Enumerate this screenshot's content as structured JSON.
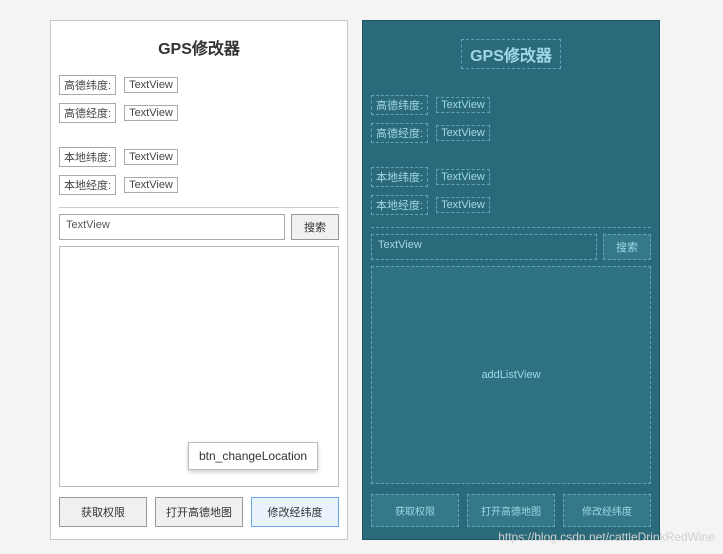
{
  "title": "GPS修改器",
  "rows": {
    "gaode_lat_label": "高德纬度:",
    "gaode_lng_label": "高德经度:",
    "local_lat_label": "本地纬度:",
    "local_lng_label": "本地经度:",
    "textview": "TextView"
  },
  "search": {
    "input_text": "TextView",
    "button": "搜索"
  },
  "list_placeholder_left": "",
  "list_placeholder_right": "addListView",
  "bottom": {
    "get_permission": "获取权限",
    "open_gaode": "打开高德地图",
    "change_loc": "修改经纬度"
  },
  "blueprint_bottom_overflow": "打开高德地图",
  "tooltip": "btn_changeLocation",
  "watermark": "https://blog.csdn.net/cattleDrinkRedWine"
}
